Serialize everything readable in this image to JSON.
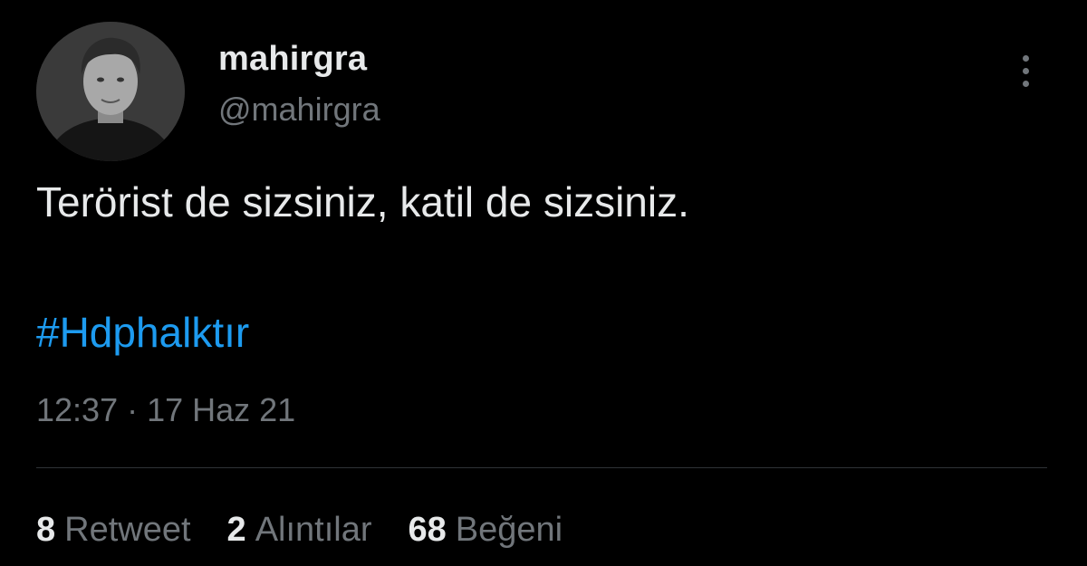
{
  "tweet": {
    "display_name": "mahirgra",
    "handle": "@mahirgra",
    "text": "Terörist de sizsiniz, katil de sizsiniz.",
    "hashtag": "#Hdphalktır",
    "timestamp": "12:37 · 17 Haz 21",
    "avatar_icon": "profile-photo",
    "more_icon": "more-vertical-icon"
  },
  "stats": {
    "retweets": {
      "count": "8",
      "label": "Retweet"
    },
    "quotes": {
      "count": "2",
      "label": "Alıntılar"
    },
    "likes": {
      "count": "68",
      "label": "Beğeni"
    }
  },
  "colors": {
    "background": "#000000",
    "primary_text": "#e7e9ea",
    "secondary_text": "#71767b",
    "link": "#1d9bf0",
    "divider": "#2f3336"
  }
}
